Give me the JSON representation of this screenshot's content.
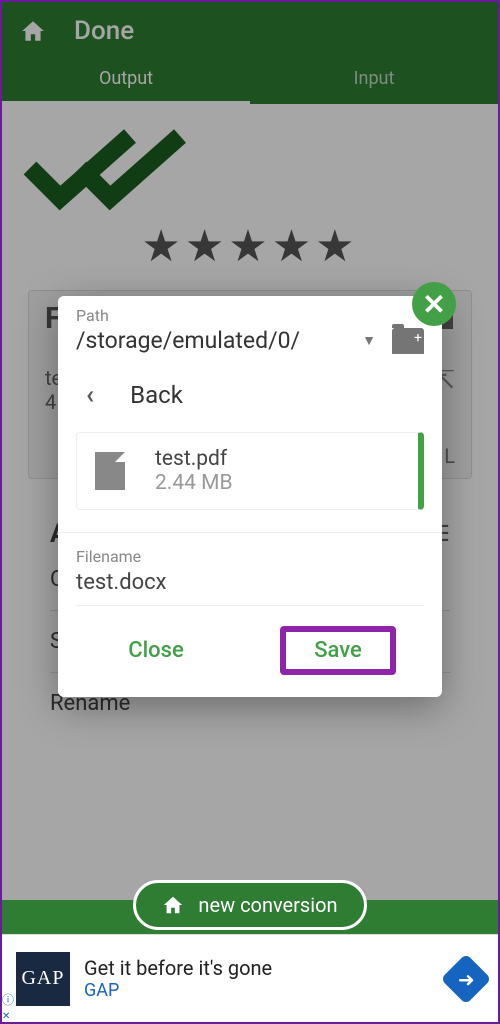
{
  "appbar": {
    "title": "Done"
  },
  "tabs": {
    "output": "Output",
    "input": "Input"
  },
  "bg": {
    "actions_label": "A",
    "save_as": "Save as",
    "rename": "Rename",
    "c": "C",
    "f": "F",
    "te": "te",
    "four": "4",
    "l": "L"
  },
  "newconv": {
    "label": "new conversion"
  },
  "ad": {
    "title": "Get it before it's gone",
    "brand": "GAP",
    "logo": "GAP",
    "info": "ⓘ",
    "close": "✕"
  },
  "dialog": {
    "path_label": "Path",
    "path_value": "/storage/emulated/0/",
    "back_label": "Back",
    "file": {
      "name": "test.pdf",
      "size": "2.44 MB"
    },
    "filename_label": "Filename",
    "filename_value": "test.docx",
    "close_btn": "Close",
    "save_btn": "Save"
  }
}
